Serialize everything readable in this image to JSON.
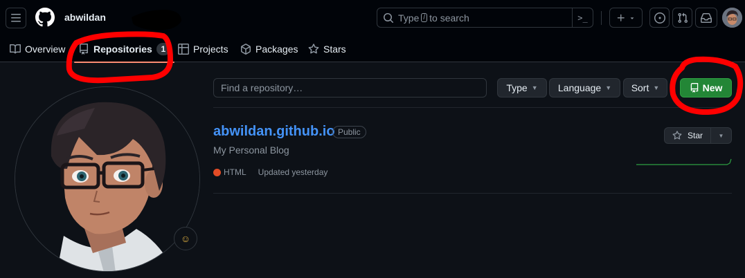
{
  "header": {
    "username": "abwildan",
    "search_prefix": "Type",
    "search_key": "/",
    "search_suffix": "to search",
    "command_glyph": ">_"
  },
  "tabs": [
    {
      "label": "Overview",
      "icon": "book-icon"
    },
    {
      "label": "Repositories",
      "icon": "repo-icon",
      "count": "1"
    },
    {
      "label": "Projects",
      "icon": "table-icon"
    },
    {
      "label": "Packages",
      "icon": "package-icon"
    },
    {
      "label": "Stars",
      "icon": "star-icon"
    }
  ],
  "filters": {
    "find_placeholder": "Find a repository…",
    "type_label": "Type",
    "language_label": "Language",
    "sort_label": "Sort",
    "new_label": "New"
  },
  "repo": {
    "name": "abwildan.github.io",
    "visibility": "Public",
    "description": "My Personal Blog",
    "language": "HTML",
    "language_color": "#e34c26",
    "updated": "Updated yesterday",
    "star_label": "Star"
  },
  "status_emoji": "☺",
  "colors": {
    "accent_link": "#4493f8",
    "new_button": "#238636",
    "tab_underline": "#fd8c73",
    "annotation": "#ff0000"
  }
}
